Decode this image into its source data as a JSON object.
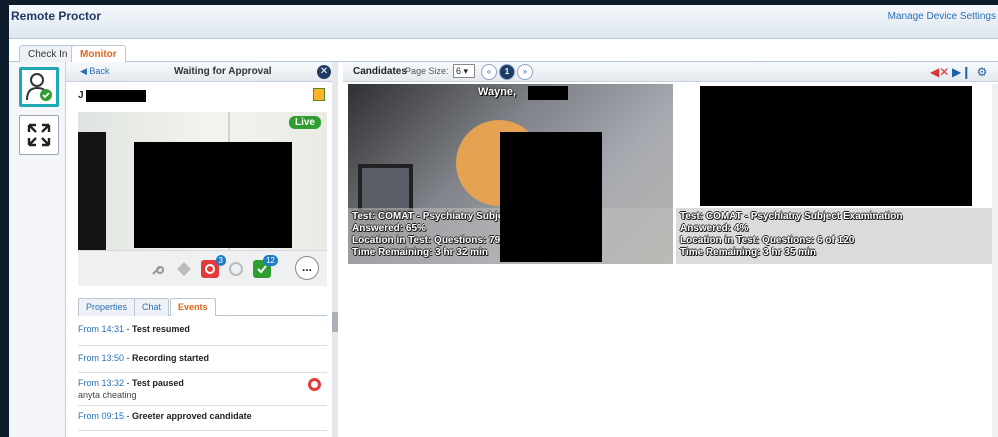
{
  "app": {
    "title": "Remote Proctor",
    "manage_link": "Manage Device Settings"
  },
  "tabs": [
    {
      "label": "Check In"
    },
    {
      "label": "Monitor"
    }
  ],
  "left_panel": {
    "back_label": "Back",
    "title": "Waiting for Approval",
    "candidate_initial": "J",
    "live_label": "Live",
    "toolbar": {
      "pause_badge": "3",
      "approve_badge": "12",
      "more_label": "..."
    },
    "subtabs": [
      {
        "label": "Properties"
      },
      {
        "label": "Chat"
      },
      {
        "label": "Events"
      }
    ],
    "events": [
      {
        "time": "From 14:31",
        "label": "Test resumed",
        "note": ""
      },
      {
        "time": "From 13:50",
        "label": "Recording started",
        "note": ""
      },
      {
        "time": "From 13:32",
        "label": "Test paused",
        "note": "anyta cheating"
      },
      {
        "time": "From 09:15",
        "label": "Greeter approved candidate",
        "note": ""
      }
    ]
  },
  "candidates": {
    "title": "Candidates",
    "page_size_label": "Page Size:",
    "page_size_value": "6",
    "pager": {
      "prev": "«",
      "current": "1",
      "next": "»"
    },
    "tiles": [
      {
        "name": "Wayne,",
        "test": "Test: COMAT - Psychiatry Subje",
        "answered": "Answered: 65%",
        "location": "Location in Test: Questions: 79",
        "time": "Time Remaining: 3 hr 32 min"
      },
      {
        "name": "",
        "test": "Test: COMAT - Psychiatry Subject Examination",
        "answered": "Answered: 4%",
        "location": "Location in Test: Questions: 6 of 120",
        "time": "Time Remaining: 3 hr 35 min"
      }
    ]
  },
  "colors": {
    "accent": "#e0661b",
    "brand": "#1f3b63",
    "link": "#2a6fb5",
    "live": "#2f9d2f",
    "focus": "#1ea7b5"
  }
}
